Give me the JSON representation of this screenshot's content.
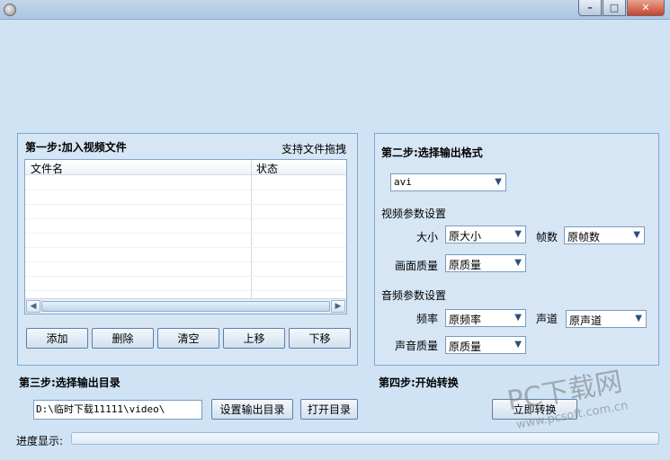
{
  "window": {
    "minimize_glyph": "–",
    "maximize_glyph": "□",
    "close_glyph": "✕"
  },
  "step1": {
    "title": "第一步:加入视频文件",
    "drag_hint": "支持文件拖拽",
    "columns": [
      "文件名",
      "状态"
    ],
    "rows": [],
    "buttons": {
      "add": "添加",
      "delete": "删除",
      "clear": "清空",
      "move_up": "上移",
      "move_down": "下移"
    }
  },
  "step2": {
    "title": "第二步:选择输出格式",
    "format": "avi",
    "video_section": "视频参数设置",
    "size_label": "大小",
    "size_value": "原大小",
    "fps_label": "帧数",
    "fps_value": "原帧数",
    "quality_label": "画面质量",
    "quality_value": "原质量",
    "audio_section": "音频参数设置",
    "sample_rate_label": "频率",
    "sample_rate_value": "原频率",
    "channel_label": "声道",
    "channel_value": "原声道",
    "audio_quality_label": "声音质量",
    "audio_quality_value": "原质量"
  },
  "step3": {
    "title": "第三步:选择输出目录",
    "output_path": "D:\\临时下载11111\\video\\",
    "set_dir_button": "设置输出目录",
    "open_dir_button": "打开目录"
  },
  "step4": {
    "title": "第四步:开始转换",
    "convert_button": "立即转换"
  },
  "progress": {
    "label": "进度显示:",
    "value": 0
  },
  "watermark": {
    "brand": "PC下载网",
    "url": "www.pcsoft.com.cn"
  },
  "colors": {
    "background": "#cfe3f5",
    "panel_border": "#7fa7cf",
    "button_border": "#5f7fa6"
  }
}
